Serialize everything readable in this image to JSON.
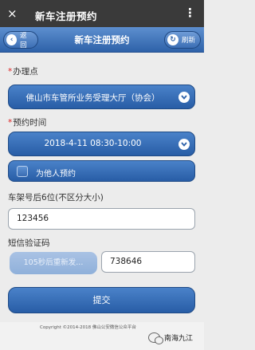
{
  "statusbar": {
    "back_icon": "×",
    "title": "新车注册预约",
    "more_icon": "⋮"
  },
  "navbar": {
    "title": "新车注册预约",
    "back_label": "返回",
    "refresh_label": "刷新"
  },
  "form": {
    "office": {
      "required_mark": "*",
      "label": "办理点",
      "value": "佛山市车管所业务受理大厅（协会）"
    },
    "time": {
      "required_mark": "*",
      "label": "预约时间",
      "value": "2018-4-11 08:30-10:00"
    },
    "proxy_checkbox_label": "为他人预约",
    "vin": {
      "label": "车架号后6位(不区分大小)",
      "value": "123456"
    },
    "sms": {
      "label": "短信验证码",
      "resend_button": "105秒后重新发...",
      "value": "738646"
    },
    "submit_label": "提交"
  },
  "footer": {
    "copyright": "Copyright ©2014-2018 佛山公安微信公众平台",
    "brand": "南海九江"
  }
}
